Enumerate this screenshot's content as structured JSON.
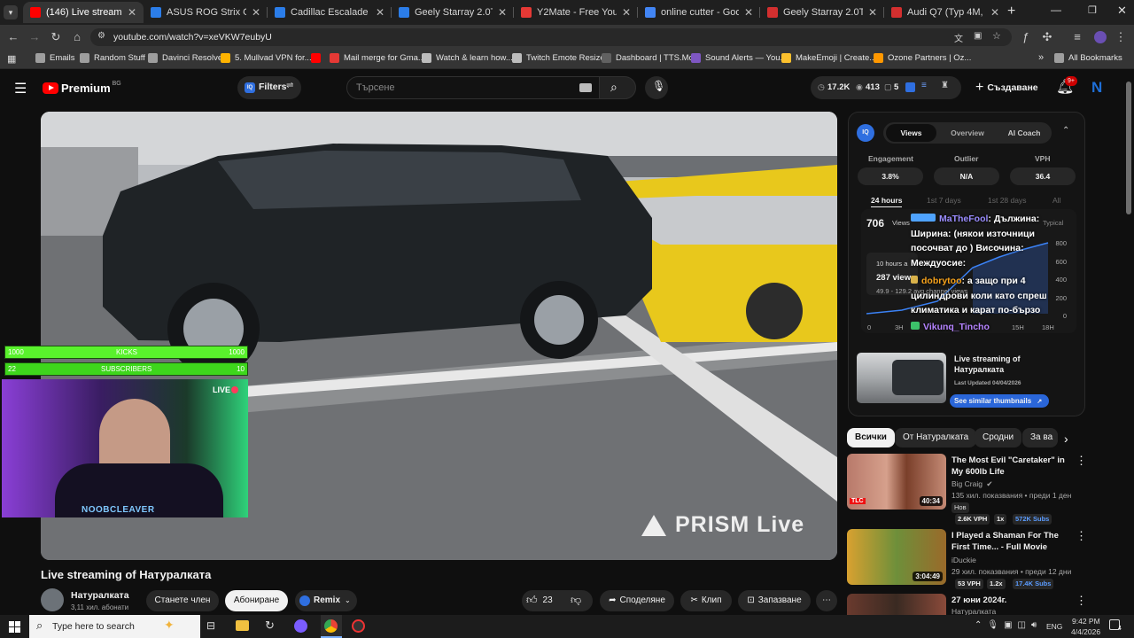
{
  "browser": {
    "tabs": [
      {
        "title": "(146) Live streaming of Н...",
        "color": "#ff0000",
        "active": true
      },
      {
        "title": "ASUS ROG Strix G16 G614",
        "color": "#2b7de9"
      },
      {
        "title": "Cadillac Escalade V-series",
        "color": "#2b7de9"
      },
      {
        "title": "Geely Starray 2.0T AWD G",
        "color": "#2b7de9"
      },
      {
        "title": "Y2Mate - Free YouTube D",
        "color": "#e53935"
      },
      {
        "title": "online cutter - Google Se",
        "color": "#4285f4"
      },
      {
        "title": "Geely Starray 2.0T (238 H",
        "color": "#d32f2f"
      },
      {
        "title": "Audi Q7 (Typ 4M, facelift",
        "color": "#d32f2f"
      }
    ],
    "url": "youtube.com/watch?v=xeVKW7eubyU",
    "bookmarks": [
      {
        "label": "Emails",
        "color": "#9e9e9e"
      },
      {
        "label": "Random Stuff",
        "color": "#9e9e9e"
      },
      {
        "label": "Davinci Resolve",
        "color": "#9e9e9e"
      },
      {
        "label": "5. Mullvad VPN for...",
        "color": "#ffb300"
      },
      {
        "label": "",
        "color": "#ff0000"
      },
      {
        "label": "Mail merge for Gma...",
        "color": "#e53935"
      },
      {
        "label": "Watch & learn how...",
        "color": "#bdbdbd"
      },
      {
        "label": "Twitch Emote Resizer",
        "color": "#bdbdbd"
      },
      {
        "label": "Dashboard | TTS.Mo...",
        "color": "#616161"
      },
      {
        "label": "Sound Alerts — You...",
        "color": "#7e57c2"
      },
      {
        "label": "MakeEmoji | Create...",
        "color": "#fbc02d"
      },
      {
        "label": "Ozone Partners | Oz...",
        "color": "#ff9800"
      }
    ],
    "all_bookmarks": "All Bookmarks"
  },
  "yt": {
    "logo": "Premium",
    "region": "BG",
    "filters": "Filters",
    "search_placeholder": "Търсене",
    "header_stats": [
      "17.2K",
      "413",
      "5"
    ],
    "create": "Създаване",
    "notif_count": "9+"
  },
  "video": {
    "title": "Live streaming of Натуралката",
    "kicks_left": "1000",
    "kicks_label": "KICKS",
    "kicks_right": "1000",
    "subs_left": "22",
    "subs_label": "SUBSCRIBERS",
    "subs_right": "10",
    "live": "LIVE",
    "cam_name": "NOOBCLEAVER",
    "prism": "PRISM Live"
  },
  "channel": {
    "name": "Натуралката",
    "subs": "3,11 хил. абонати",
    "join": "Станете член",
    "subscribe": "Абониране",
    "remix": "Remix",
    "likes": "23",
    "share": "Споделяне",
    "clip": "Клип",
    "save": "Запазване"
  },
  "iq": {
    "tabs": [
      "Views",
      "Overview",
      "AI Coach"
    ],
    "labels": [
      "Engagement",
      "Outlier",
      "VPH"
    ],
    "values": [
      "3.8%",
      "N/A",
      "36.4"
    ],
    "ranges": [
      "24 hours",
      "1st 7 days",
      "1st 28 days",
      "All"
    ],
    "views": "706",
    "views_label": "Views",
    "typical": "Typical",
    "ago": "10 hours a",
    "views287": "287 views",
    "range_text": "49.9 - 129.2 avg channel views",
    "y_ticks": [
      "800",
      "600",
      "400",
      "200",
      "0"
    ],
    "x_ticks": [
      "0",
      "3H",
      "15H",
      "18H"
    ],
    "thumb_title": "Live streaming of Натуралката",
    "thumb_updated": "Last Updated 04/04/2026",
    "similar": "See similar thumbnails"
  },
  "chat": [
    {
      "user": "MaTheFool",
      "text": ": Дължина: Ширина: (някои източници посочват до ) Височина: Междуосие:"
    },
    {
      "user": "dobrytoo",
      "text": ": а защо при 4 цилиндрови коли като спреш климатика и карат по-бързо"
    },
    {
      "user": "Vikunq_Tincho",
      "text": ""
    }
  ],
  "filter_chips": [
    "Всички",
    "От Натуралката",
    "Сродни",
    "За ва"
  ],
  "recs": [
    {
      "title": "The Most Evil \"Caretaker\" in My 600lb Life",
      "channel": "Big Craig",
      "meta": "135 хил. показвания • преди 1 ден",
      "tag": "Нов",
      "dur": "40:34",
      "b1": "2.6K VPH",
      "b2": "1x",
      "b3": "572K Subs"
    },
    {
      "title": "I Played a Shaman For The First Time... - Full Movie",
      "channel": "iDuckie",
      "meta": "29 хил. показвания • преди 12 дни",
      "dur": "3:04:49",
      "b1": "53 VPH",
      "b2": "1.2x",
      "b3": "17.4K Subs"
    },
    {
      "title": "27 юни 2024г.",
      "channel": "Натуралката"
    }
  ],
  "taskbar": {
    "search": "Type here to search",
    "lang": "ENG",
    "time": "9:42 PM",
    "date": "4/4/2026",
    "notif": "4"
  }
}
